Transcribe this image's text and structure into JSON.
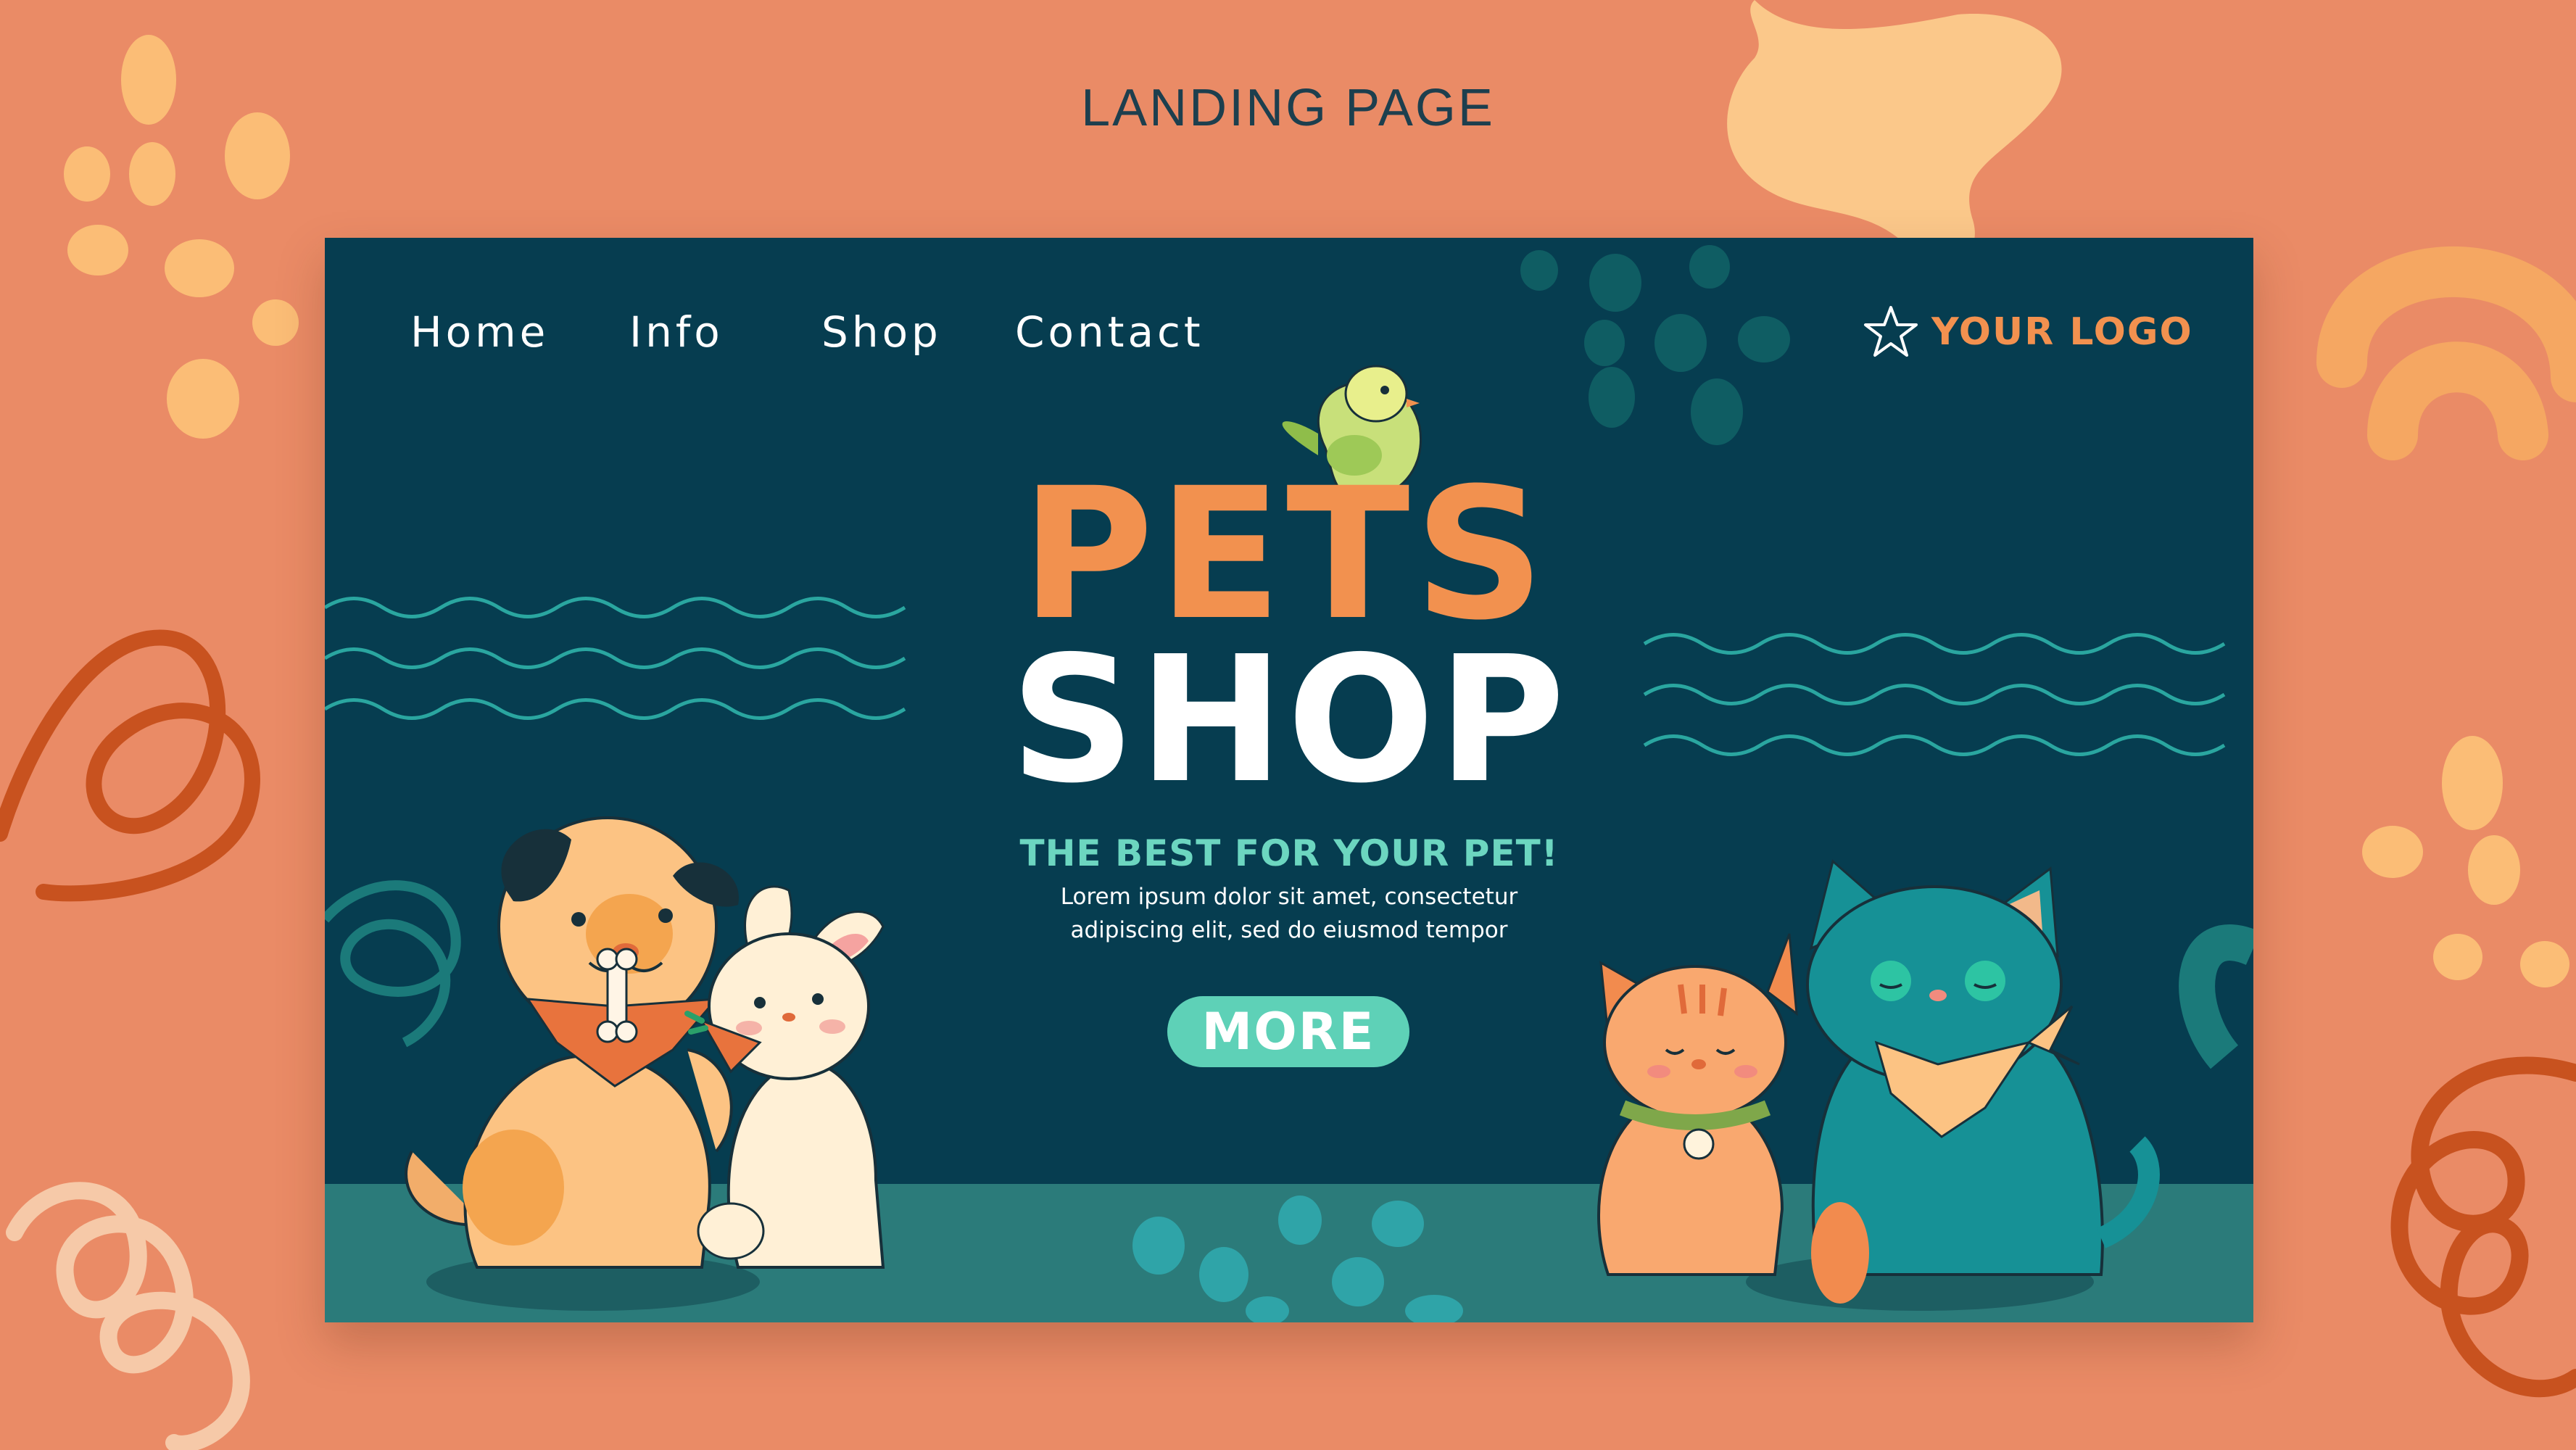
{
  "page_title": "LANDING PAGE",
  "nav": {
    "items": [
      {
        "label": "Home"
      },
      {
        "label": "Info"
      },
      {
        "label": "Shop"
      },
      {
        "label": "Contact"
      }
    ]
  },
  "logo": {
    "text": "YOUR LOGO",
    "icon": "star-icon"
  },
  "hero": {
    "title_line1": "PETS",
    "title_line2": "SHOP",
    "tagline": "THE BEST FOR YOUR PET!",
    "body_line1": "Lorem ipsum dolor sit amet, consectetur",
    "body_line2": "adipiscing elit, sed do eiusmod tempor",
    "cta_label": "MORE"
  },
  "colors": {
    "outer_background": "#ea8b66",
    "panel_background": "#063d50",
    "accent_orange": "#f2914f",
    "accent_teal": "#5ed1b7",
    "floor": "#2b7b7a"
  }
}
